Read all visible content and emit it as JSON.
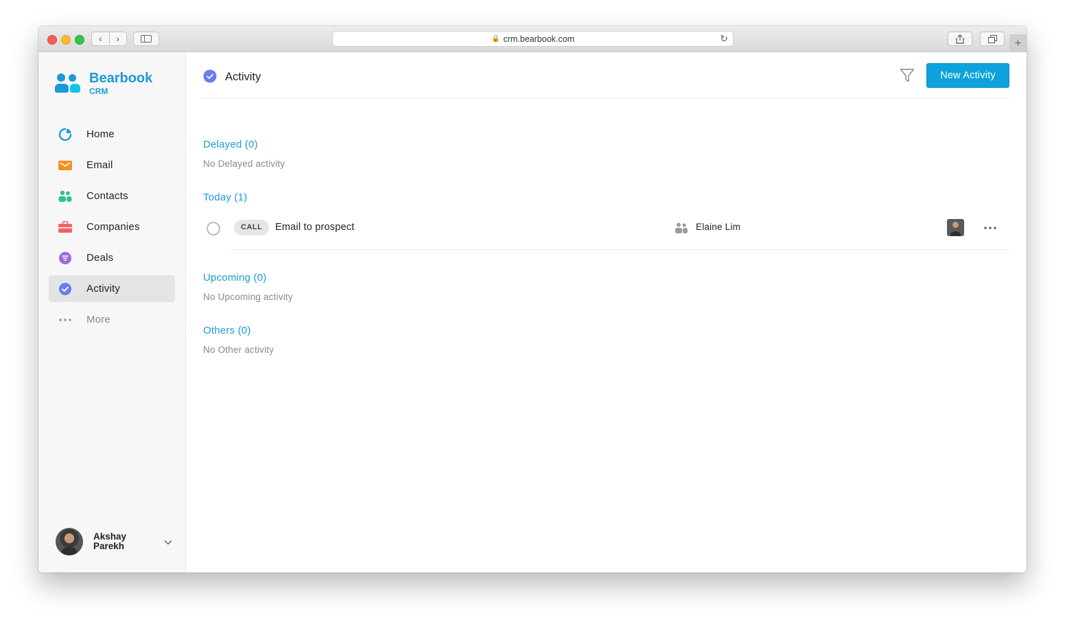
{
  "browser": {
    "url": "crm.bearbook.com",
    "nav_back": "‹",
    "nav_forward": "›",
    "new_tab": "+"
  },
  "brand": {
    "name": "Bearbook",
    "sub": "CRM",
    "color": "#1a9bd7"
  },
  "sidebar": {
    "items": [
      {
        "label": "Home",
        "icon": "pie-chart-icon",
        "color": "#1a9bd7"
      },
      {
        "label": "Email",
        "icon": "envelope-icon",
        "color": "#f5901e"
      },
      {
        "label": "Contacts",
        "icon": "people-icon",
        "color": "#27c48f"
      },
      {
        "label": "Companies",
        "icon": "briefcase-icon",
        "color": "#f06262"
      },
      {
        "label": "Deals",
        "icon": "deals-icon",
        "color": "#9b6ce0"
      },
      {
        "label": "Activity",
        "icon": "check-icon",
        "color": "#6b7cf0",
        "active": true
      },
      {
        "label": "More",
        "icon": "dots-icon",
        "color": "#888888"
      }
    ]
  },
  "profile": {
    "name_line1": "Akshay",
    "name_line2": "Parekh"
  },
  "header": {
    "title": "Activity",
    "new_button": "New Activity",
    "button_color": "#0da2dc"
  },
  "sections": {
    "delayed": {
      "title": "Delayed (0)",
      "empty": "No Delayed activity"
    },
    "today": {
      "title": "Today (1)"
    },
    "upcoming": {
      "title": "Upcoming (0)",
      "empty": "No Upcoming activity"
    },
    "others": {
      "title": "Others (0)",
      "empty": "No Other activity"
    }
  },
  "activities": [
    {
      "type": "CALL",
      "title": "Email to prospect",
      "contact": "Elaine Lim"
    }
  ]
}
